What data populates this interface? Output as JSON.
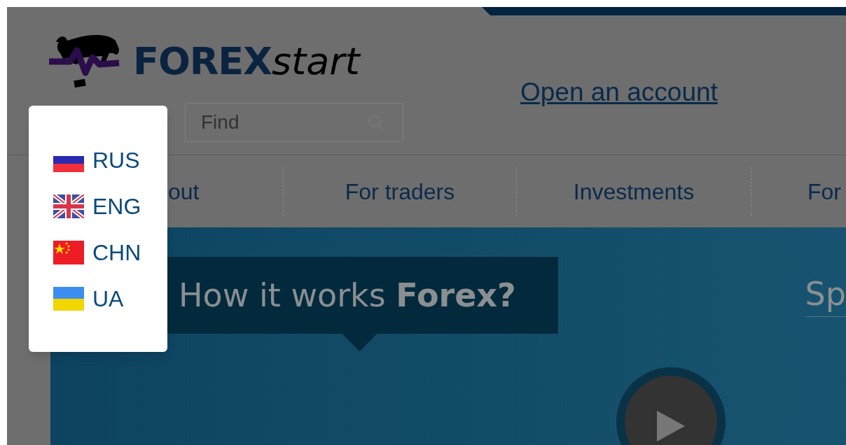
{
  "logo": {
    "brand_bold": "FOREX",
    "brand_italic": "start"
  },
  "account_link": "Open an account",
  "search": {
    "placeholder": "Find"
  },
  "nav": [
    {
      "label": "out"
    },
    {
      "label": "For traders"
    },
    {
      "label": "Investments"
    },
    {
      "label": "For"
    }
  ],
  "hero": {
    "title": "How it works **Forex?**",
    "side_text": "Sp"
  },
  "language_menu": [
    {
      "code": "RUS",
      "kind": "ru"
    },
    {
      "code": "ENG",
      "kind": "uk"
    },
    {
      "code": "CHN",
      "kind": "cn"
    },
    {
      "code": "UA",
      "kind": "ua"
    }
  ]
}
